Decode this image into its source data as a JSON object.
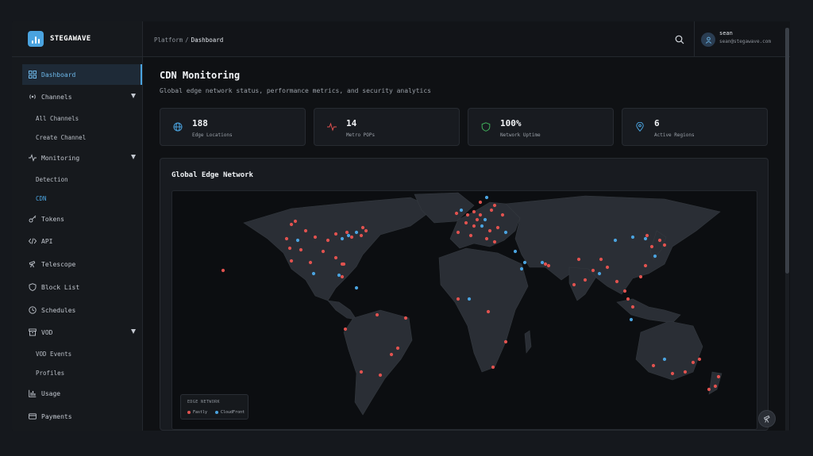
{
  "brand": {
    "name": "STEGAWAVE"
  },
  "sidebar": {
    "items": [
      {
        "label": "Dashboard",
        "icon": "grid-icon"
      },
      {
        "label": "Channels",
        "icon": "broadcast-icon"
      },
      {
        "label": "All Channels"
      },
      {
        "label": "Create Channel"
      },
      {
        "label": "Monitoring",
        "icon": "activity-icon"
      },
      {
        "label": "Detection"
      },
      {
        "label": "CDN"
      },
      {
        "label": "Tokens",
        "icon": "key-icon"
      },
      {
        "label": "API",
        "icon": "code-icon"
      },
      {
        "label": "Telescope",
        "icon": "telescope-icon"
      },
      {
        "label": "Block List",
        "icon": "shield-icon"
      },
      {
        "label": "Schedules",
        "icon": "clock-icon"
      },
      {
        "label": "VOD",
        "icon": "archive-icon"
      },
      {
        "label": "VOD Events"
      },
      {
        "label": "Profiles"
      },
      {
        "label": "Usage",
        "icon": "bar-chart-icon"
      },
      {
        "label": "Payments",
        "icon": "card-icon"
      }
    ]
  },
  "header": {
    "breadcrumb": [
      "Platform",
      "Dashboard"
    ],
    "breadcrumb_sep": "/",
    "user": {
      "name": "sean",
      "email": "sean@stegawave.com"
    }
  },
  "page": {
    "title": "CDN Monitoring",
    "subtitle": "Global edge network status, performance metrics, and security analytics"
  },
  "stats": [
    {
      "value": "188",
      "label": "Edge Locations",
      "icon": "globe-icon",
      "color": "#4aa3df"
    },
    {
      "value": "14",
      "label": "Metro POPs",
      "icon": "pulse-icon",
      "color": "#e0524f"
    },
    {
      "value": "100%",
      "label": "Network Uptime",
      "icon": "shield-check-icon",
      "color": "#3fae5a"
    },
    {
      "value": "6",
      "label": "Active Regions",
      "icon": "pin-icon",
      "color": "#4aa3df"
    }
  ],
  "map": {
    "title": "Global Edge Network",
    "legend_title": "EDGE NETWORK",
    "legend": [
      {
        "name": "Fastly",
        "color": "#e0524f"
      },
      {
        "name": "CloudFront",
        "color": "#4aa3df"
      }
    ]
  },
  "colors": {
    "accent": "#4aa3df",
    "fastly": "#e0524f",
    "cloudfront": "#4aa3df",
    "background": "#0f1114"
  }
}
